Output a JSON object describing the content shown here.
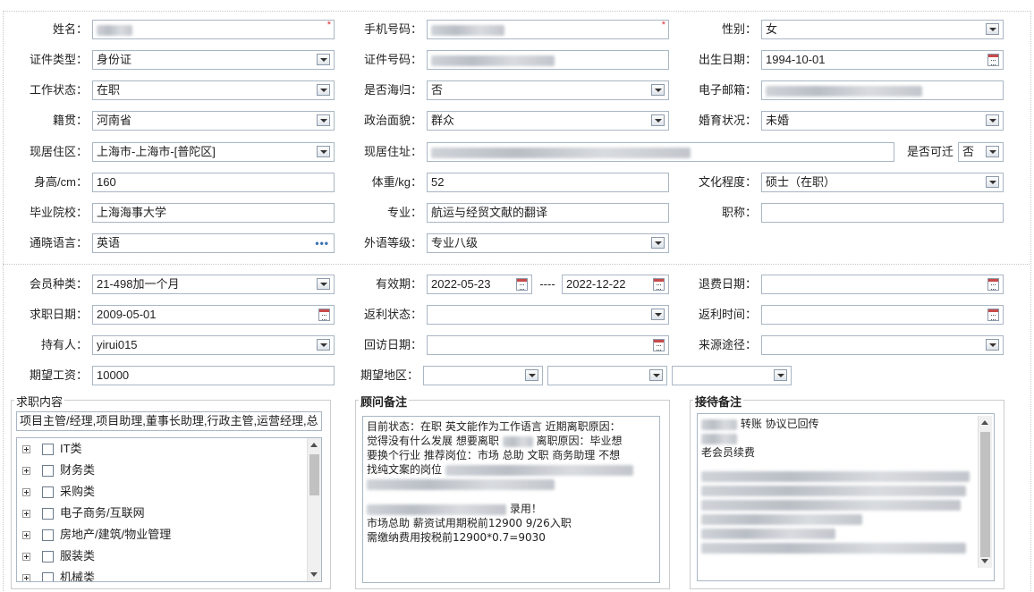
{
  "basic": {
    "name_label": "姓名：",
    "phone_label": "手机号码：",
    "gender_label": "性别：",
    "gender_value": "女",
    "idtype_label": "证件类型：",
    "idtype_value": "身份证",
    "idno_label": "证件号码：",
    "birth_label": "出生日期：",
    "birth_value": "1994-10-01",
    "workstatus_label": "工作状态：",
    "workstatus_value": "在职",
    "returnee_label": "是否海归：",
    "returnee_value": "否",
    "email_label": "电子邮箱：",
    "native_label": "籍贯：",
    "native_value": "河南省",
    "political_label": "政治面貌：",
    "political_value": "群众",
    "marital_label": "婚育状况：",
    "marital_value": "未婚",
    "residence_label": "现居住区：",
    "residence_value": "上海市-上海市-[普陀区]",
    "address_label": "现居住址：",
    "relocate_label": "是否可迁",
    "relocate_value": "否",
    "height_label": "身高/cm：",
    "height_value": "160",
    "weight_label": "体重/kg：",
    "weight_value": "52",
    "education_label": "文化程度：",
    "education_value": "硕士（在职）",
    "school_label": "毕业院校：",
    "school_value": "上海海事大学",
    "major_label": "专业：",
    "major_value": "航运与经贸文献的翻译",
    "title_label": "职称：",
    "title_value": "",
    "language_label": "通晓语言：",
    "language_value": "英语",
    "foreign_level_label": "外语等级：",
    "foreign_level_value": "专业八级"
  },
  "member": {
    "type_label": "会员种类：",
    "type_value": "21-498加一个月",
    "valid_label": "有效期：",
    "valid_from": "2022-05-23",
    "valid_sep": "----",
    "valid_to": "2022-12-22",
    "refund_date_label": "退费日期：",
    "refund_date_value": "",
    "job_date_label": "求职日期：",
    "job_date_value": "2009-05-01",
    "rebate_status_label": "返利状态：",
    "rebate_status_value": "",
    "rebate_time_label": "返利时间：",
    "rebate_time_value": "",
    "holder_label": "持有人：",
    "holder_value": "yirui015",
    "visit_label": "回访日期：",
    "visit_value": "",
    "source_label": "来源途径：",
    "source_value": "",
    "salary_label": "期望工资：",
    "salary_value": "10000",
    "area_label": "期望地区："
  },
  "job_content": {
    "title": "求职内容",
    "summary": "项目主管/经理,项目助理,董事长助理,行政主管,运营经理,总",
    "tree": [
      "IT类",
      "财务类",
      "采购类",
      "电子商务/互联网",
      "房地产/建筑/物业管理",
      "服装类",
      "机械类"
    ]
  },
  "advisor_notes": {
    "title": "顾问备注",
    "lines": [
      "目前状态：在职 英文能作为工作语言 近期离职原因：",
      "觉得没有什么发展 想要离职",
      "离职原因：毕业想",
      "要换个行业 推荐岗位：市场 总助 文职 商务助理 不想",
      "找纯文案的岗位",
      "录用！",
      "市场总助 薪资试用期税前12900 9/26入职",
      "需缴纳费用按税前12900*0.7=9030"
    ]
  },
  "reception_notes": {
    "title": "接待备注",
    "lines": [
      "转账 协议已回传",
      "老会员续费"
    ]
  },
  "icons": {
    "dropdown": "chevron-down-icon",
    "calendar": "calendar-icon",
    "more": "ellipsis-icon",
    "expand": "plus-expand-icon"
  },
  "colors": {
    "border": "#a9b6c4",
    "required": "#e03030",
    "accent": "#3a6fb0"
  }
}
